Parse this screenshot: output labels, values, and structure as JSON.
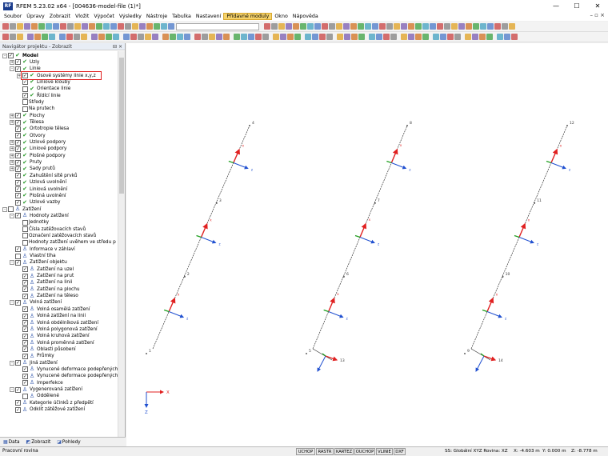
{
  "window": {
    "title": "RFEM 5.23.02 x64 - [004636-model-file (1)*]",
    "app_badge": "RF",
    "minimize": "—",
    "maximize": "☐",
    "close": "✕"
  },
  "menu": {
    "items": [
      "Soubor",
      "Úpravy",
      "Zobrazit",
      "Vložit",
      "Výpočet",
      "Výsledky",
      "Nástroje",
      "Tabulka",
      "Nastavení",
      "Přídavné moduly",
      "Okno",
      "Nápověda"
    ],
    "active_index": 9,
    "right_controls": "– ▫ ×"
  },
  "navigator": {
    "title": "Navigátor projektu - Zobrazit",
    "pin": "⊟ ×",
    "tree": [
      {
        "label": "Model",
        "level": 0,
        "exp": "-",
        "chk": true,
        "icon": "green",
        "bold": true
      },
      {
        "label": "Uzly",
        "level": 1,
        "exp": "+",
        "chk": true,
        "icon": "green"
      },
      {
        "label": "Linie",
        "level": 1,
        "exp": "-",
        "chk": true,
        "icon": "green"
      },
      {
        "label": "Osové systémy linie x,y,z",
        "level": 2,
        "exp": "+",
        "chk": true,
        "icon": "green"
      },
      {
        "label": "Liniové klouby",
        "level": 2,
        "exp": "",
        "chk": true,
        "icon": "green"
      },
      {
        "label": "Orientace linie",
        "level": 2,
        "exp": "",
        "chk": false,
        "icon": "green"
      },
      {
        "label": "Řídící linie",
        "level": 2,
        "exp": "",
        "chk": true,
        "icon": "green"
      },
      {
        "label": "Středy",
        "level": 2,
        "exp": "",
        "chk": false,
        "icon": "none"
      },
      {
        "label": "Na prutech",
        "level": 2,
        "exp": "",
        "chk": false,
        "icon": "none"
      },
      {
        "label": "Plochy",
        "level": 1,
        "exp": "+",
        "chk": true,
        "icon": "green"
      },
      {
        "label": "Tělesa",
        "level": 1,
        "exp": "+",
        "chk": true,
        "icon": "green"
      },
      {
        "label": "Ortotropie tělesa",
        "level": 1,
        "exp": "",
        "chk": true,
        "icon": "green"
      },
      {
        "label": "Otvory",
        "level": 1,
        "exp": "",
        "chk": true,
        "icon": "green"
      },
      {
        "label": "Uzlové podpory",
        "level": 1,
        "exp": "+",
        "chk": true,
        "icon": "green"
      },
      {
        "label": "Liniové podpory",
        "level": 1,
        "exp": "+",
        "chk": true,
        "icon": "green"
      },
      {
        "label": "Plošné podpory",
        "level": 1,
        "exp": "+",
        "chk": true,
        "icon": "green"
      },
      {
        "label": "Pruty",
        "level": 1,
        "exp": "+",
        "chk": true,
        "icon": "green"
      },
      {
        "label": "Sady prutů",
        "level": 1,
        "exp": "+",
        "chk": true,
        "icon": "green"
      },
      {
        "label": "Zahuštění sítě prvků",
        "level": 1,
        "exp": "",
        "chk": true,
        "icon": "green"
      },
      {
        "label": "Uzlová uvolnění",
        "level": 1,
        "exp": "",
        "chk": true,
        "icon": "green"
      },
      {
        "label": "Liniová uvolnění",
        "level": 1,
        "exp": "",
        "chk": true,
        "icon": "green"
      },
      {
        "label": "Plošná uvolnění",
        "level": 1,
        "exp": "",
        "chk": true,
        "icon": "green"
      },
      {
        "label": "Uzlové vazby",
        "level": 1,
        "exp": "",
        "chk": true,
        "icon": "green"
      },
      {
        "label": "Zatížení",
        "level": 0,
        "exp": "-",
        "chk": false,
        "icon": "load"
      },
      {
        "label": "Hodnoty zatížení",
        "level": 1,
        "exp": "-",
        "chk": true,
        "icon": "load"
      },
      {
        "label": "Jednotky",
        "level": 2,
        "exp": "",
        "chk": false,
        "icon": "none"
      },
      {
        "label": "Čísla zatěžovacích stavů",
        "level": 2,
        "exp": "",
        "chk": false,
        "icon": "none"
      },
      {
        "label": "Označení zatěžovacích stavů",
        "level": 2,
        "exp": "",
        "chk": false,
        "icon": "none"
      },
      {
        "label": "Hodnoty zatížení uvěhem ve středu p",
        "level": 2,
        "exp": "",
        "chk": false,
        "icon": "none"
      },
      {
        "label": "Informace v záhlaví",
        "level": 1,
        "exp": "",
        "chk": true,
        "icon": "load"
      },
      {
        "label": "Vlastní tíha",
        "level": 1,
        "exp": "",
        "chk": false,
        "icon": "load"
      },
      {
        "label": "Zatížení objektu",
        "level": 1,
        "exp": "-",
        "chk": true,
        "icon": "load"
      },
      {
        "label": "Zatížení na uzel",
        "level": 2,
        "exp": "",
        "chk": true,
        "icon": "load"
      },
      {
        "label": "Zatížení na prut",
        "level": 2,
        "exp": "",
        "chk": true,
        "icon": "load"
      },
      {
        "label": "Zatížení na linii",
        "level": 2,
        "exp": "",
        "chk": true,
        "icon": "load"
      },
      {
        "label": "Zatížení na plochu",
        "level": 2,
        "exp": "",
        "chk": true,
        "icon": "load"
      },
      {
        "label": "Zatížení na těleso",
        "level": 2,
        "exp": "",
        "chk": true,
        "icon": "load"
      },
      {
        "label": "Volná zatížení",
        "level": 1,
        "exp": "-",
        "chk": true,
        "icon": "load"
      },
      {
        "label": "Volná osamělá zatížení",
        "level": 2,
        "exp": "",
        "chk": true,
        "icon": "load"
      },
      {
        "label": "Volná zatížení na linii",
        "level": 2,
        "exp": "",
        "chk": true,
        "icon": "load"
      },
      {
        "label": "Volná obdélníková zatížení",
        "level": 2,
        "exp": "",
        "chk": true,
        "icon": "load"
      },
      {
        "label": "Volná polygonová zatížení",
        "level": 2,
        "exp": "",
        "chk": true,
        "icon": "load"
      },
      {
        "label": "Volná kruhová zatížení",
        "level": 2,
        "exp": "",
        "chk": true,
        "icon": "load"
      },
      {
        "label": "Volná proměnná zatížení",
        "level": 2,
        "exp": "",
        "chk": true,
        "icon": "load"
      },
      {
        "label": "Oblasti působení",
        "level": 2,
        "exp": "",
        "chk": true,
        "icon": "load"
      },
      {
        "label": "Průmky",
        "level": 2,
        "exp": "",
        "chk": true,
        "icon": "load"
      },
      {
        "label": "Jiná zatížení",
        "level": 1,
        "exp": "-",
        "chk": true,
        "icon": "load"
      },
      {
        "label": "Vynucené deformace podepřených u",
        "level": 2,
        "exp": "",
        "chk": true,
        "icon": "load"
      },
      {
        "label": "Vynucené deformace podepřených li",
        "level": 2,
        "exp": "",
        "chk": true,
        "icon": "load"
      },
      {
        "label": "Imperfekce",
        "level": 2,
        "exp": "",
        "chk": true,
        "icon": "load"
      },
      {
        "label": "Vygenerovaná zatížení",
        "level": 1,
        "exp": "-",
        "chk": true,
        "icon": "load"
      },
      {
        "label": "Oddělené",
        "level": 2,
        "exp": "",
        "chk": false,
        "icon": "load"
      },
      {
        "label": "Kategorie účinků z předpětí",
        "level": 1,
        "exp": "",
        "chk": true,
        "icon": "load"
      },
      {
        "label": "Odklit zátěžové zatížení",
        "level": 1,
        "exp": "",
        "chk": true,
        "icon": "load"
      }
    ],
    "tabs": [
      "Data",
      "Zobrazit",
      "Pohledy"
    ]
  },
  "viewport": {
    "node_labels": [
      "4",
      "3",
      "2",
      "1",
      "8",
      "7",
      "6",
      "5",
      "12",
      "11",
      "10",
      "9",
      "13",
      "14"
    ],
    "axis_labels": {
      "x": "x",
      "y": "y",
      "z": "z"
    },
    "global_axes": {
      "x": "X",
      "z": "Z"
    }
  },
  "status": {
    "text": "Pracovní rovina",
    "buttons": [
      "UCHOP",
      "RASTR",
      "KARTEZ",
      "OUCHOP",
      "VLINIE",
      "DXF"
    ],
    "coord_system": "SS: Globální XYZ  Rovina: XZ",
    "x": "X: -4.603 m",
    "y": "Y: 0.000 m",
    "z": "Z: -8.778 m"
  },
  "colors": {
    "accent_menu": "#f5d26a",
    "highlight": "#e02020",
    "axis_x": "#e02020",
    "axis_y": "#20a020",
    "axis_z": "#2050d0"
  }
}
